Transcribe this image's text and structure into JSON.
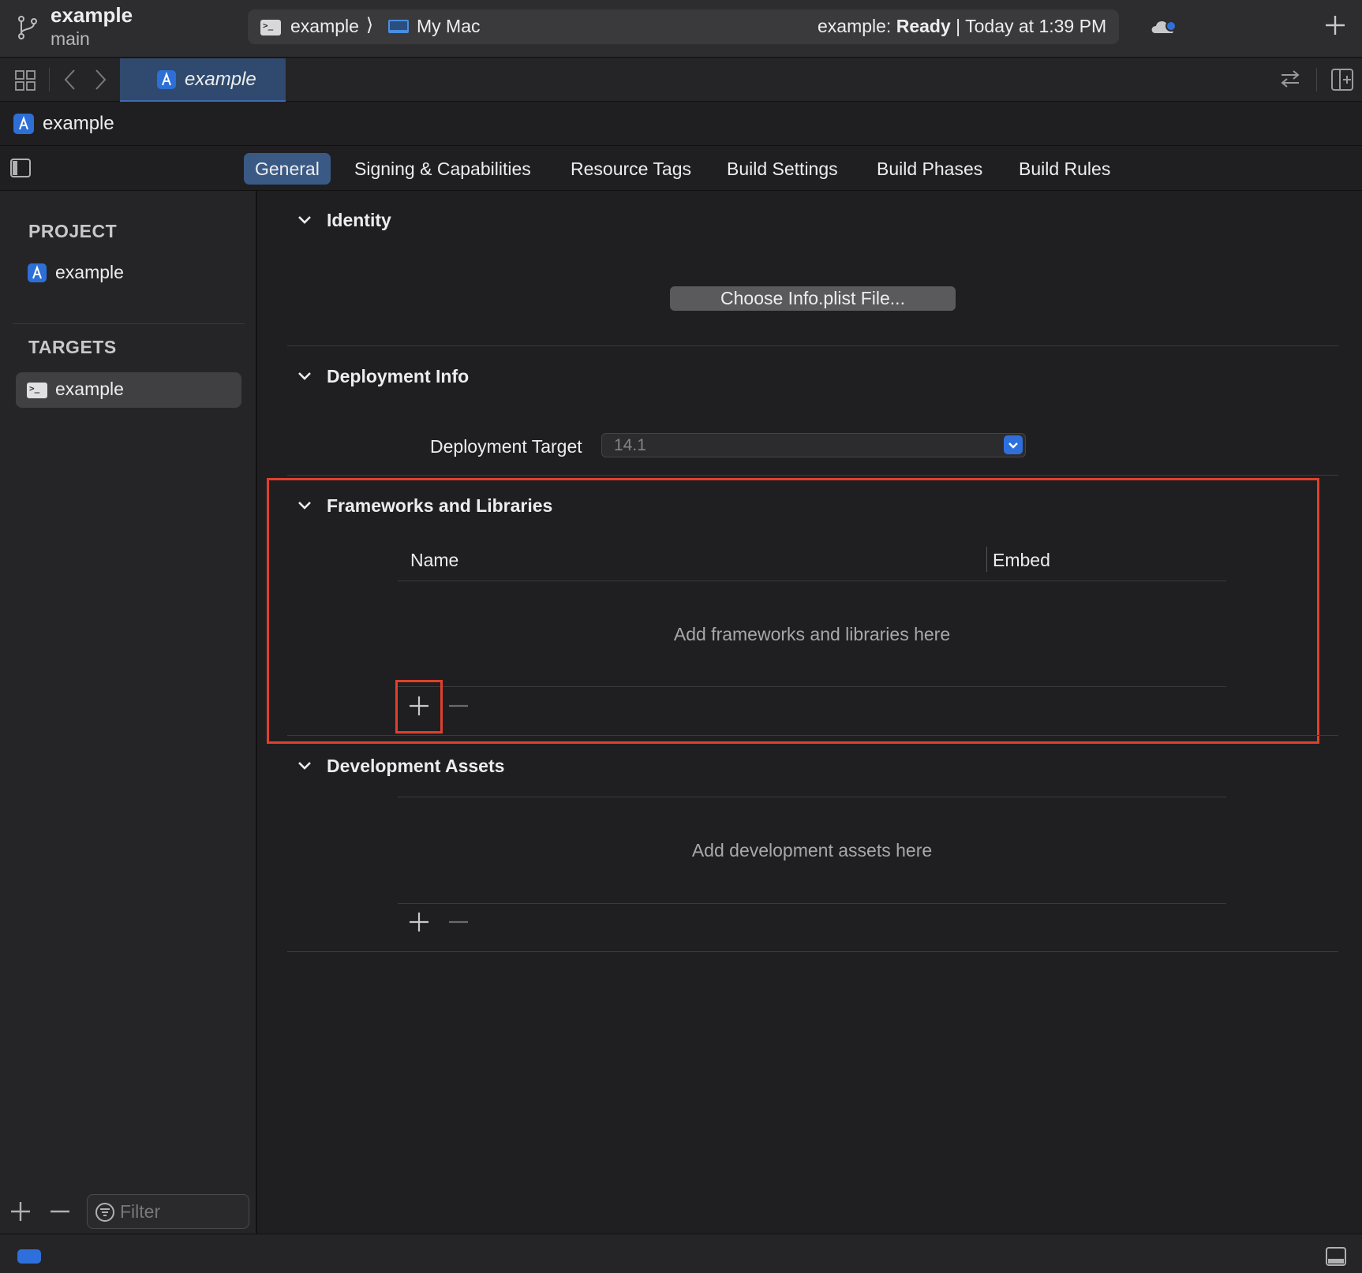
{
  "window": {
    "project_name": "example",
    "branch": "main",
    "scheme": "example",
    "scheme_separator": "⟩",
    "destination": "My Mac",
    "status_prefix": "example:",
    "status_state": "Ready",
    "status_suffix": "| Today at 1:39 PM"
  },
  "tab": {
    "label": "example"
  },
  "jumpbar": {
    "label": "example"
  },
  "editor_tabs": [
    {
      "label": "General",
      "selected": true
    },
    {
      "label": "Signing & Capabilities"
    },
    {
      "label": "Resource Tags"
    },
    {
      "label": "Build Settings"
    },
    {
      "label": "Build Phases"
    },
    {
      "label": "Build Rules"
    }
  ],
  "sidebar": {
    "project_header": "PROJECT",
    "project_item": "example",
    "targets_header": "TARGETS",
    "target_item": "example",
    "filter_placeholder": "Filter"
  },
  "sections": {
    "identity": {
      "title": "Identity",
      "choose_button": "Choose Info.plist File..."
    },
    "deployment": {
      "title": "Deployment Info",
      "target_label": "Deployment Target",
      "target_value": "14.1"
    },
    "frameworks": {
      "title": "Frameworks and Libraries",
      "columns": [
        "Name",
        "Embed"
      ],
      "empty_text": "Add frameworks and libraries here"
    },
    "dev_assets": {
      "title": "Development Assets",
      "empty_text": "Add development assets here"
    }
  },
  "colors": {
    "accent": "#2f6fdc",
    "selected_tab": "#3a5a85",
    "highlight": "#e0402c",
    "background": "#1f1f21"
  },
  "icons": {
    "branch": "branch-icon",
    "scheme": "terminal-icon",
    "destination": "laptop-icon",
    "cloud": "cloud-icon",
    "add": "plus-icon",
    "remove": "minus-icon",
    "filter": "filter-icon"
  }
}
